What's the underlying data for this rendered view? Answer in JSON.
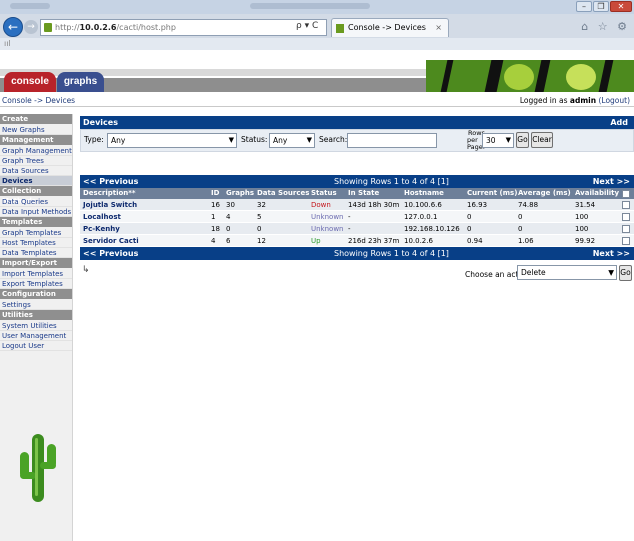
{
  "browser": {
    "url_prefix": "http://",
    "url_host": "10.0.2.6",
    "url_path": "/cacti/host.php",
    "tab_title": "Console -> Devices",
    "tab_close": "×",
    "addr_tools": "ρ ▾ C",
    "back_icon": "←",
    "forward_icon": "→",
    "nav_icons": "⌂ ☆ ⚙",
    "favbar_icon": "ııl",
    "window_buttons": {
      "min": "–",
      "max": "❐",
      "close": "✕"
    }
  },
  "header": {
    "console_tab": "console",
    "graphs_tab": "graphs"
  },
  "breadcrumb": {
    "text": "Console -> Devices",
    "login_prefix": "Logged in as",
    "user": "admin",
    "logout": "(Logout)"
  },
  "sidebar": {
    "groups": [
      {
        "header": "Create",
        "items": [
          "New Graphs"
        ]
      },
      {
        "header": "Management",
        "items": [
          "Graph Management",
          "Graph Trees",
          "Data Sources",
          "Devices"
        ]
      },
      {
        "header": "Collection Methods",
        "items": [
          "Data Queries",
          "Data Input Methods"
        ]
      },
      {
        "header": "Templates",
        "items": [
          "Graph Templates",
          "Host Templates",
          "Data Templates"
        ]
      },
      {
        "header": "Import/Export",
        "items": [
          "Import Templates",
          "Export Templates"
        ]
      },
      {
        "header": "Configuration",
        "items": [
          "Settings"
        ]
      },
      {
        "header": "Utilities",
        "items": [
          "System Utilities",
          "User Management",
          "Logout User"
        ]
      }
    ],
    "active_item": "Devices"
  },
  "devices_panel": {
    "title": "Devices",
    "add_link": "Add",
    "filter": {
      "type_label": "Type:",
      "type_value": "Any",
      "status_label": "Status:",
      "status_value": "Any",
      "search_label": "Search:",
      "search_value": "",
      "rows_label_1": "Rows",
      "rows_label_2": "per",
      "rows_label_3": "Page:",
      "rows_value": "30",
      "go_button": "Go",
      "clear_button": "Clear"
    }
  },
  "table": {
    "prev": "<< Previous",
    "next": "Next >>",
    "showing": "Showing Rows 1 to 4 of 4 [1]",
    "columns": [
      "Description**",
      "ID",
      "Graphs",
      "Data Sources",
      "Status",
      "In State",
      "Hostname",
      "Current (ms)",
      "Average (ms)",
      "Availability"
    ],
    "rows": [
      {
        "description": "Jojutla Switch",
        "id": "16",
        "graphs": "30",
        "data_sources": "32",
        "status": "Down",
        "in_state": "143d 18h 30m",
        "hostname": "10.100.6.6",
        "current": "16.93",
        "average": "74.88",
        "availability": "31.54"
      },
      {
        "description": "Localhost",
        "id": "1",
        "graphs": "4",
        "data_sources": "5",
        "status": "Unknown",
        "in_state": "-",
        "hostname": "127.0.0.1",
        "current": "0",
        "average": "0",
        "availability": "100"
      },
      {
        "description": "Pc-Kenhy",
        "id": "18",
        "graphs": "0",
        "data_sources": "0",
        "status": "Unknown",
        "in_state": "-",
        "hostname": "192.168.10.126",
        "current": "0",
        "average": "0",
        "availability": "100"
      },
      {
        "description": "Servidor Cacti",
        "id": "4",
        "graphs": "6",
        "data_sources": "12",
        "status": "Up",
        "in_state": "216d 23h 37m",
        "hostname": "10.0.2.6",
        "current": "0.94",
        "average": "1.06",
        "availability": "99.92"
      }
    ]
  },
  "actions": {
    "arrow": "↳",
    "label": "Choose an action:",
    "value": "Delete",
    "go_button": "Go"
  },
  "icons": {
    "caret": "▼"
  }
}
